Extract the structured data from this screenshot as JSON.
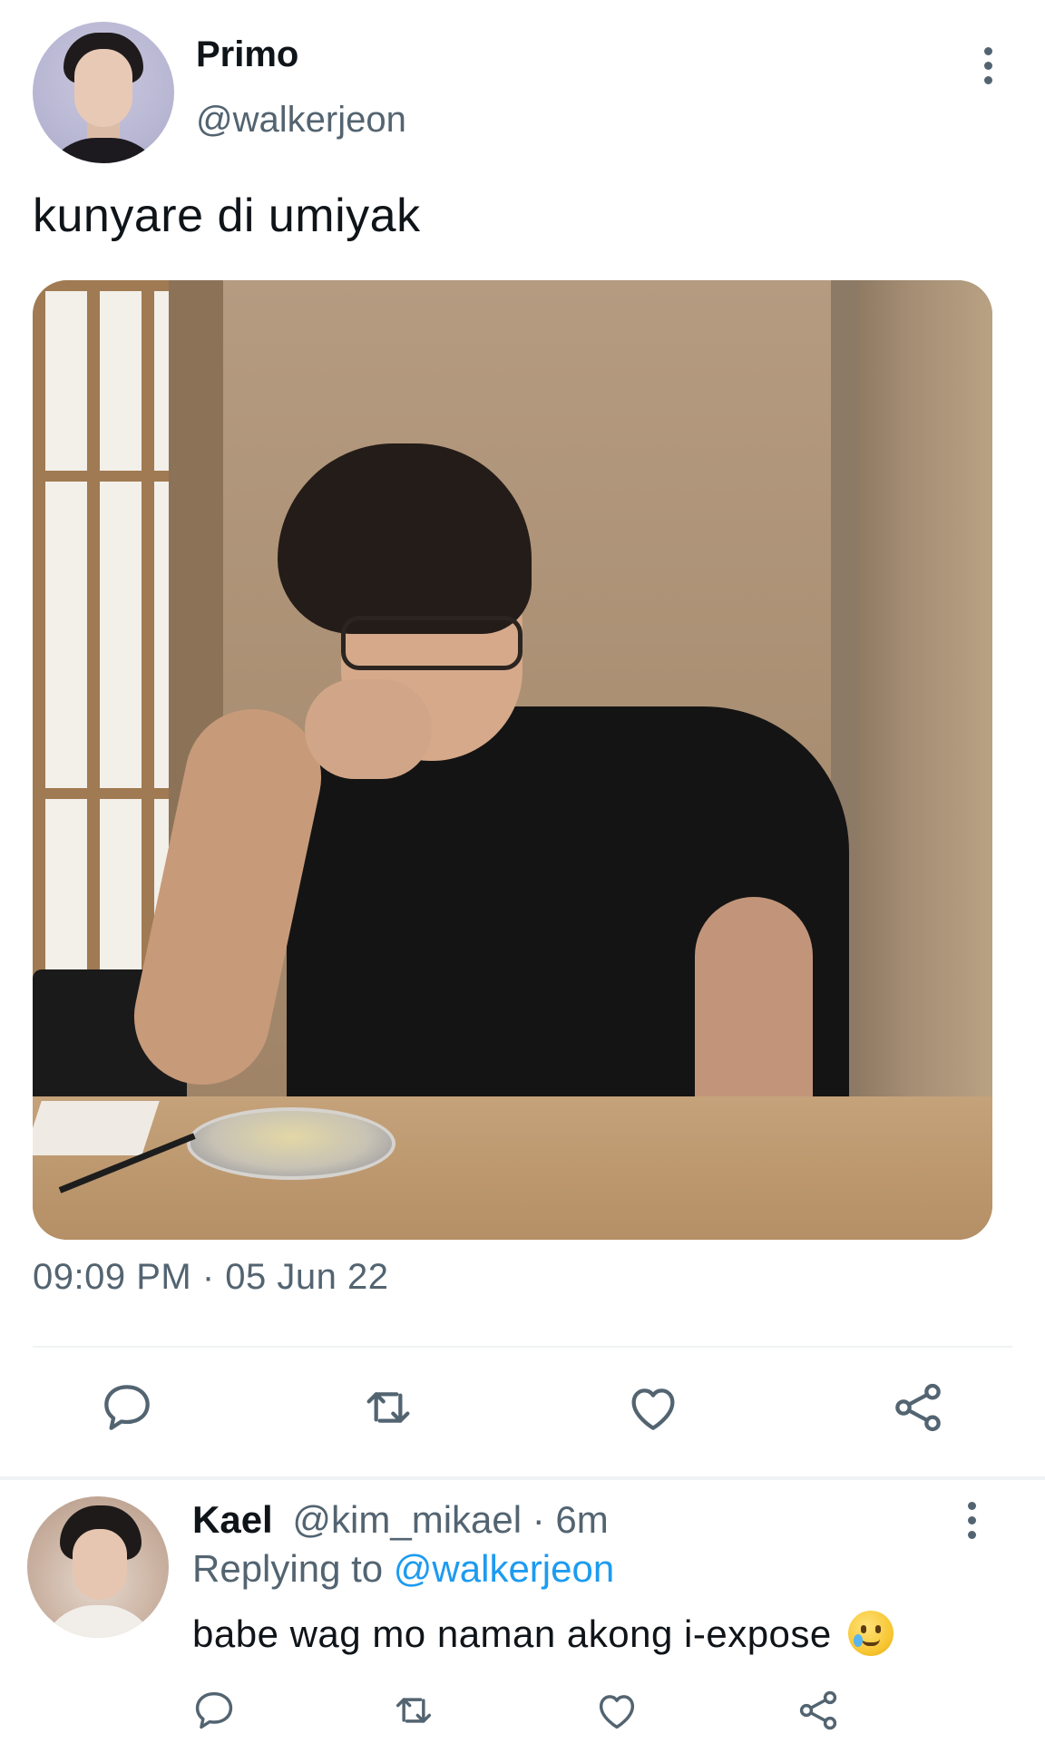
{
  "tweet": {
    "author_name": "Primo",
    "author_handle": "@walkerjeon",
    "text": "kunyare di umiyak",
    "timestamp": "09:09 PM · 05 Jun 22",
    "actions": [
      "reply-icon",
      "retweet-icon",
      "like-icon",
      "share-icon"
    ]
  },
  "reply": {
    "author_name": "Kael",
    "author_handle": "@kim_mikael",
    "separator": " · ",
    "age": "6m",
    "replying_prefix": "Replying to ",
    "replying_to": "@walkerjeon",
    "text": "babe wag mo naman akong i-expose",
    "emoji": "smiling-face-with-tear",
    "actions": [
      "reply-icon",
      "retweet-icon",
      "like-icon",
      "share-icon"
    ]
  },
  "colors": {
    "text": "#0f1419",
    "muted": "#536471",
    "link": "#1d9bf0",
    "divider": "#eff3f4"
  }
}
